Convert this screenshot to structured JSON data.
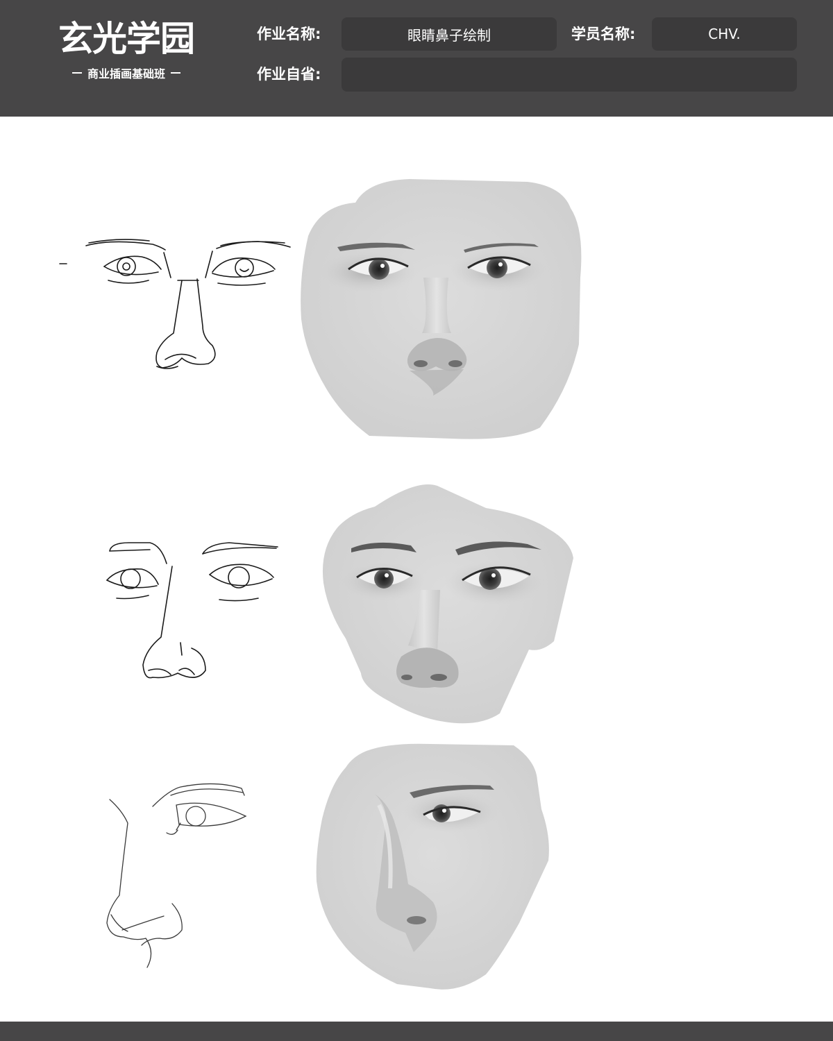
{
  "header": {
    "logo_title": "玄光学园",
    "logo_subtitle": "商业插画基础班",
    "assignment_name_label": "作业名称:",
    "assignment_name_value": "眼睛鼻子绘制",
    "student_name_label": "学员名称:",
    "student_name_value": "CHV.",
    "self_review_label": "作业自省:",
    "self_review_value": ""
  },
  "colors": {
    "header_bg": "#474647",
    "field_bg": "#3b3a3b",
    "paint_base": "#d6d6d6"
  },
  "artwork": {
    "rows": [
      {
        "view": "front",
        "sketch": "line-sketch-eyes-nose-front",
        "painting": "painted-eyes-nose-front"
      },
      {
        "view": "three-quarter",
        "sketch": "line-sketch-eyes-nose-three-quarter",
        "painting": "painted-eyes-nose-three-quarter"
      },
      {
        "view": "profile",
        "sketch": "line-sketch-eye-nose-profile",
        "painting": "painted-eye-nose-profile"
      }
    ]
  }
}
